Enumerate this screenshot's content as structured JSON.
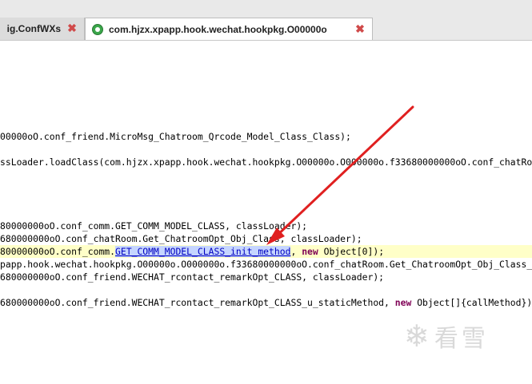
{
  "tabs": [
    {
      "title": "ig.ConfWXs",
      "active": false,
      "close": "✖"
    },
    {
      "title": "com.hjzx.xpapp.hook.wechat.hookpkg.O00000o",
      "active": true,
      "close": "✖"
    }
  ],
  "code": {
    "lines": [
      {
        "segments": [
          {
            "text": "00000oO.conf_friend.MicroMsg_Chatroom_Qrcode_Model_Class_Class);",
            "style": ""
          }
        ]
      },
      {
        "segments": [
          {
            "text": "ssLoader.loadClass(com.hjzx.xpapp.hook.wechat.hookpkg.O00000o.O000000o.f33680000000oO.conf_chatRo",
            "style": ""
          }
        ]
      },
      {
        "segments": [
          {
            "text": "80000000oO.conf_comm.GET_COMM_MODEL_CLASS, classLoader);",
            "style": ""
          }
        ]
      },
      {
        "segments": [
          {
            "text": "680000000oO.conf_chatRoom.Get_ChatroomOpt_Obj_Class, classLoader);",
            "style": ""
          }
        ]
      },
      {
        "segments": [
          {
            "text": "80000000oO.conf_comm.",
            "style": ""
          },
          {
            "text": "GET_COMM_MODEL_CLASS_init_method",
            "style": "sel"
          },
          {
            "text": ", ",
            "style": ""
          },
          {
            "text": "new",
            "style": "kw"
          },
          {
            "text": " Object[0]);",
            "style": ""
          }
        ]
      },
      {
        "segments": [
          {
            "text": "papp.hook.wechat.hookpkg.O00000o.O000000o.f33680000000oO.conf_chatRoom.Get_ChatroomOpt_Obj_Class_",
            "style": ""
          }
        ]
      },
      {
        "segments": [
          {
            "text": "680000000oO.conf_friend.WECHAT_rcontact_remarkOpt_CLASS, classLoader);",
            "style": ""
          }
        ]
      },
      {
        "segments": [
          {
            "text": "680000000oO.conf_friend.WECHAT_rcontact_remarkOpt_CLASS_u_staticMethod, ",
            "style": ""
          },
          {
            "text": "new",
            "style": "kw"
          },
          {
            "text": " Object[]{callMethod});",
            "style": ""
          }
        ]
      }
    ]
  },
  "watermark": {
    "text": "看雪",
    "icon": "snowflake-icon"
  },
  "colors": {
    "highlight": "#ffffc8",
    "selection": "#c5d5ff",
    "keyword": "#7f0055",
    "arrow": "#e02020",
    "close": "#d04a4a"
  }
}
